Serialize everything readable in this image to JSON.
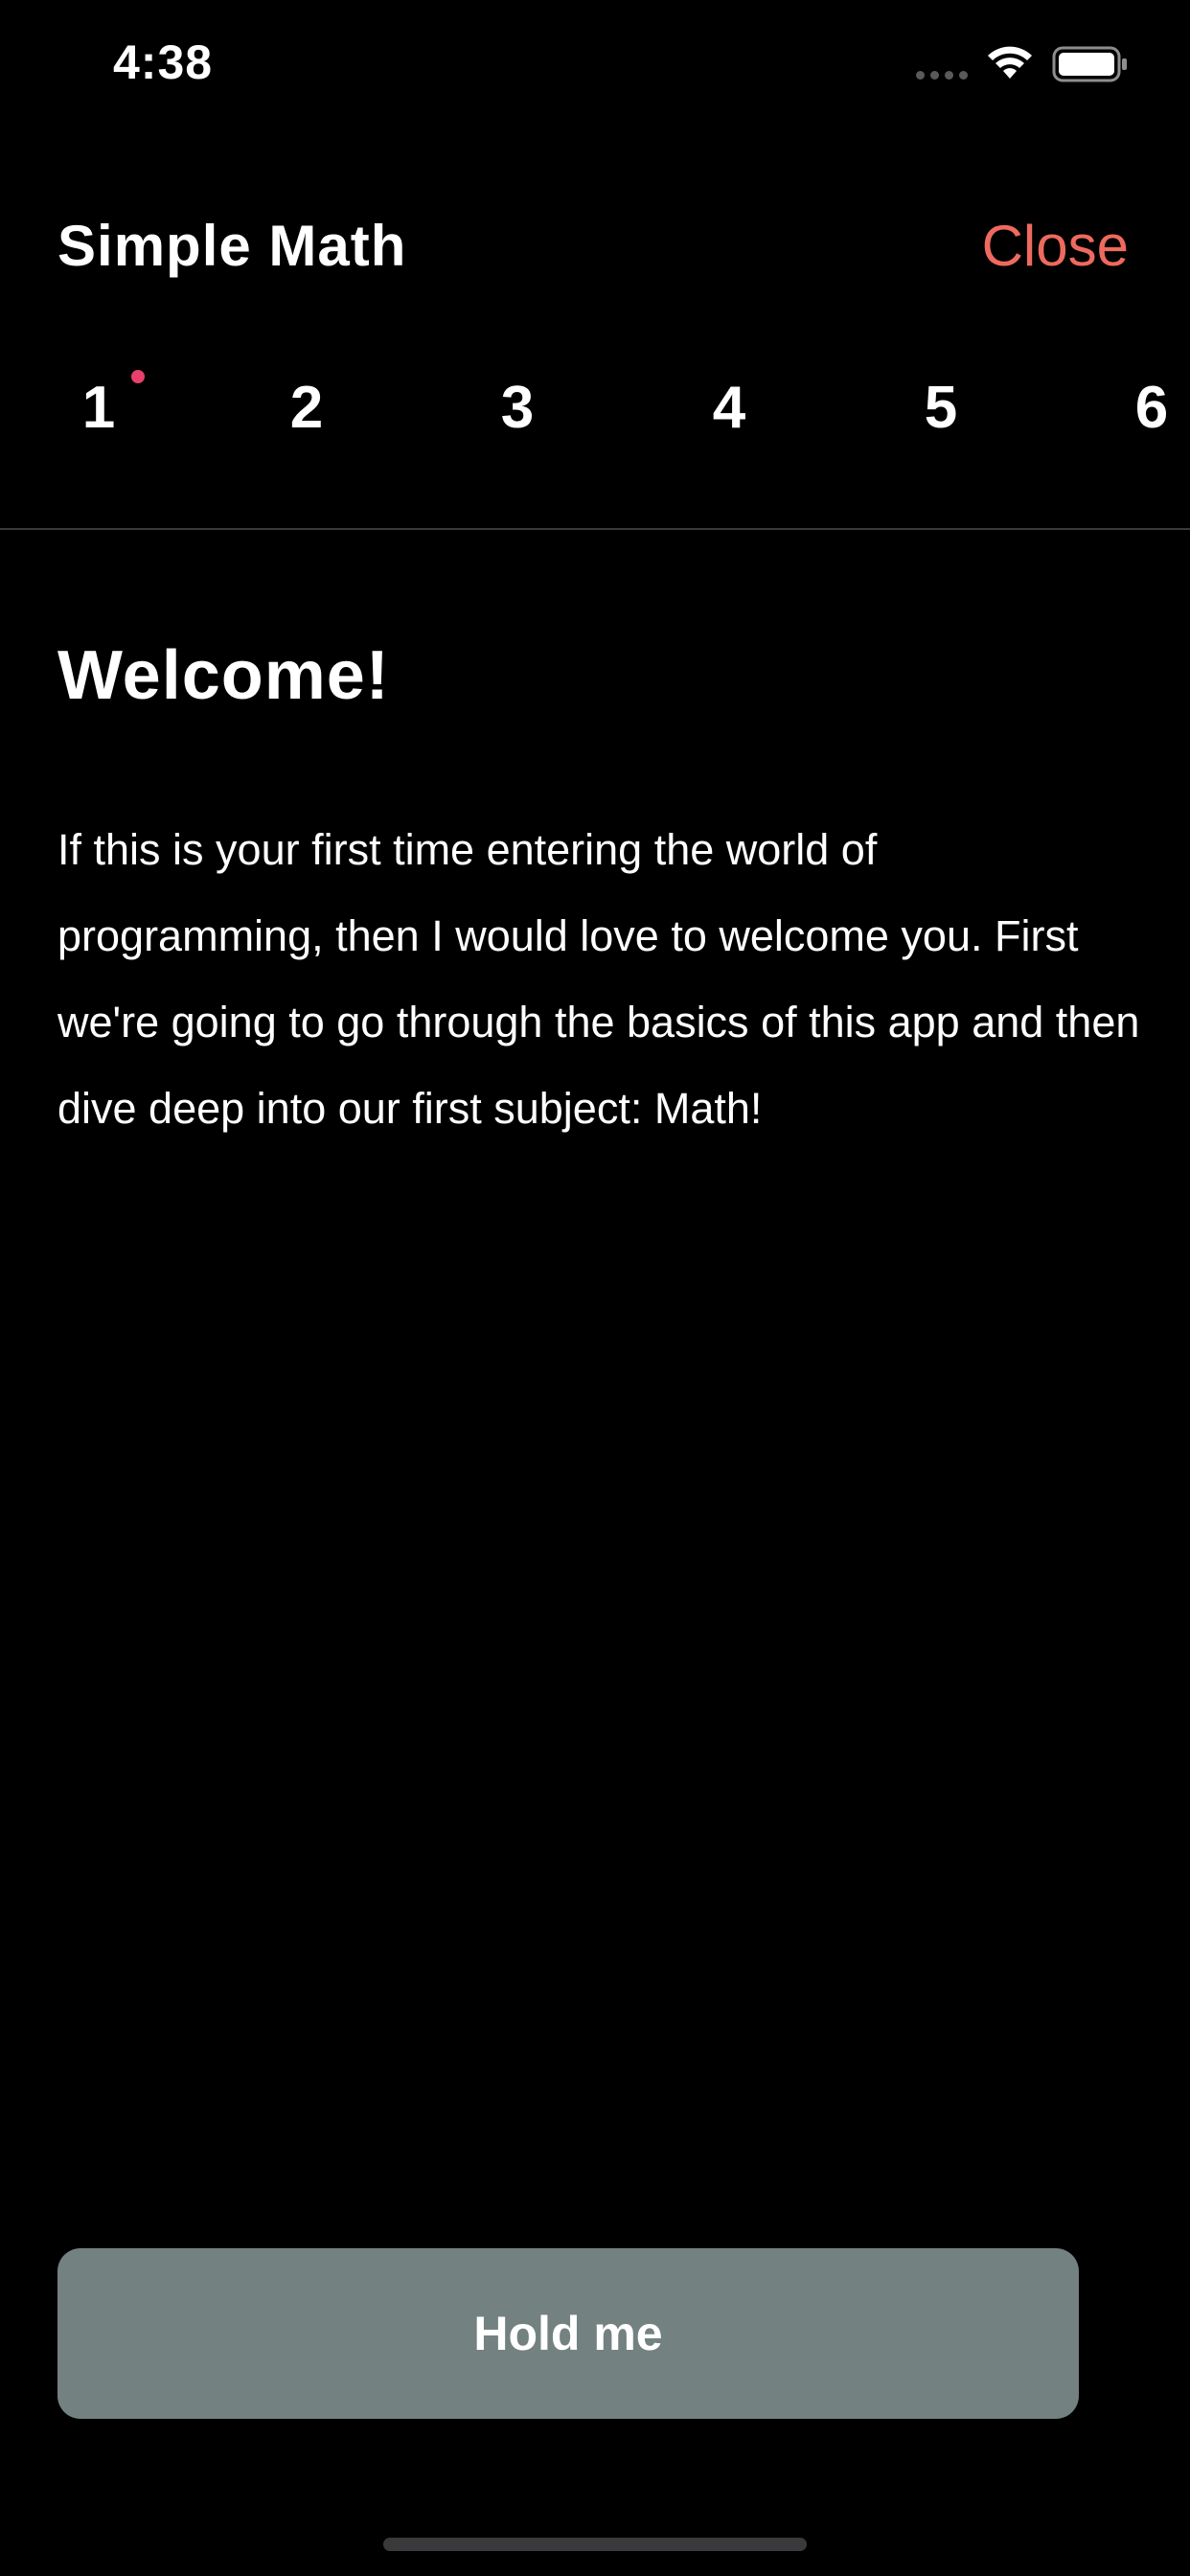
{
  "status_bar": {
    "time": "4:38"
  },
  "header": {
    "title": "Simple Math",
    "close_label": "Close"
  },
  "steps": [
    "1",
    "2",
    "3",
    "4",
    "5",
    "6"
  ],
  "content": {
    "heading": "Welcome!",
    "paragraph": "If this is your first time entering the world of programming, then I would love to welcome you. First we're going to go through the basics of this app and then dive deep into our first subject: Math!"
  },
  "action_button": {
    "label": "Hold me"
  },
  "colors": {
    "background": "#000000",
    "accent": "#ee6a5e",
    "active_dot": "#e8406a",
    "button": "#738181"
  },
  "icons": {
    "signal": "cellular-signal-icon",
    "wifi": "wifi-icon",
    "battery": "battery-icon"
  }
}
